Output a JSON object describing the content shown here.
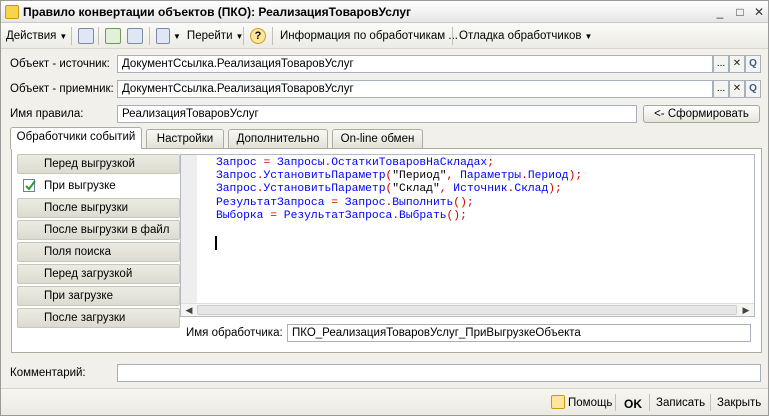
{
  "window": {
    "title": "Правило конвертации объектов (ПКО): РеализацияТоваровУслуг",
    "minimize": "_",
    "maximize": "□",
    "close": "✕"
  },
  "toolbar": {
    "actions_label": "Действия",
    "goto_label": "Перейти",
    "help_glyph": "?",
    "info_label": "Информация по обработчикам ...",
    "debug_label": "Отладка обработчиков"
  },
  "form": {
    "source_label": "Объект - источник:",
    "source_value": "ДокументСсылка.РеализацияТоваровУслуг",
    "target_label": "Объект - приемник:",
    "target_value": "ДокументСсылка.РеализацияТоваровУслуг",
    "rule_label": "Имя правила:",
    "rule_value": "РеализацияТоваровУслуг",
    "form_button": "<- Сформировать",
    "select_glyph": "...",
    "clear_glyph": "✕",
    "open_glyph": "Q"
  },
  "tabs": [
    {
      "label": "Обработчики событий"
    },
    {
      "label": "Настройки"
    },
    {
      "label": "Дополнительно"
    },
    {
      "label": "On-line обмен"
    }
  ],
  "handlers": [
    {
      "label": "Перед выгрузкой"
    },
    {
      "label": "При выгрузке"
    },
    {
      "label": "После выгрузки"
    },
    {
      "label": "После выгрузки в файл"
    },
    {
      "label": "Поля поиска"
    },
    {
      "label": "Перед загрузкой"
    },
    {
      "label": "При загрузке"
    },
    {
      "label": "После загрузки"
    }
  ],
  "code_lines": [
    "Запрос = Запросы.ОстаткиТоваровНаСкладах;",
    "Запрос.УстановитьПараметр(\"Период\", Параметры.Период);",
    "Запрос.УстановитьПараметр(\"Склад\", Источник.Склад);",
    "РезультатЗапроса = Запрос.Выполнить();",
    "Выборка = РезультатЗапроса.Выбрать();"
  ],
  "handler_name_label": "Имя обработчика:",
  "handler_name_value": "ПКО_РеализацияТоваровУслуг_ПриВыгрузкеОбъекта",
  "comment_label": "Комментарий:",
  "comment_value": "",
  "footer": {
    "help": "Помощь",
    "ok": "OK",
    "save": "Записать",
    "close": "Закрыть"
  },
  "colors": {
    "code_keyword": "#0000ff",
    "code_operator": "#cc0000",
    "code_string": "#000000"
  }
}
